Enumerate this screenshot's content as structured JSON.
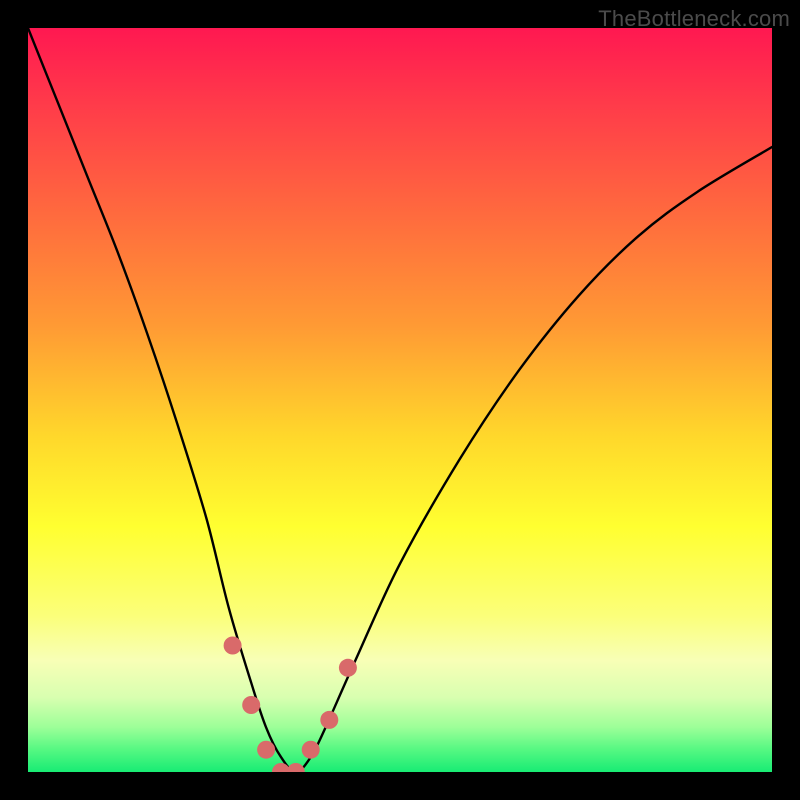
{
  "watermark": "TheBottleneck.com",
  "chart_data": {
    "type": "line",
    "title": "",
    "xlabel": "",
    "ylabel": "",
    "xlim": [
      0,
      100
    ],
    "ylim": [
      0,
      100
    ],
    "series": [
      {
        "name": "bottleneck-curve",
        "x": [
          0,
          4,
          8,
          12,
          16,
          20,
          24,
          27,
          30,
          32,
          34,
          36,
          38,
          40,
          44,
          50,
          58,
          66,
          74,
          82,
          90,
          100
        ],
        "values": [
          100,
          90,
          80,
          70,
          59,
          47,
          34,
          22,
          12,
          6,
          2,
          0,
          2,
          6,
          15,
          28,
          42,
          54,
          64,
          72,
          78,
          84
        ]
      }
    ],
    "markers": {
      "name": "highlight-dots",
      "color": "#d96a6a",
      "x": [
        27.5,
        30,
        32,
        34,
        36,
        38,
        40.5,
        43
      ],
      "values": [
        17,
        9,
        3,
        0,
        0,
        3,
        7,
        14
      ]
    },
    "gradient_stops": [
      {
        "pos": 0,
        "color": "#ff1851"
      },
      {
        "pos": 25,
        "color": "#ff6a3e"
      },
      {
        "pos": 55,
        "color": "#ffd82b"
      },
      {
        "pos": 85,
        "color": "#f8ffb6"
      },
      {
        "pos": 100,
        "color": "#18ec74"
      }
    ]
  }
}
